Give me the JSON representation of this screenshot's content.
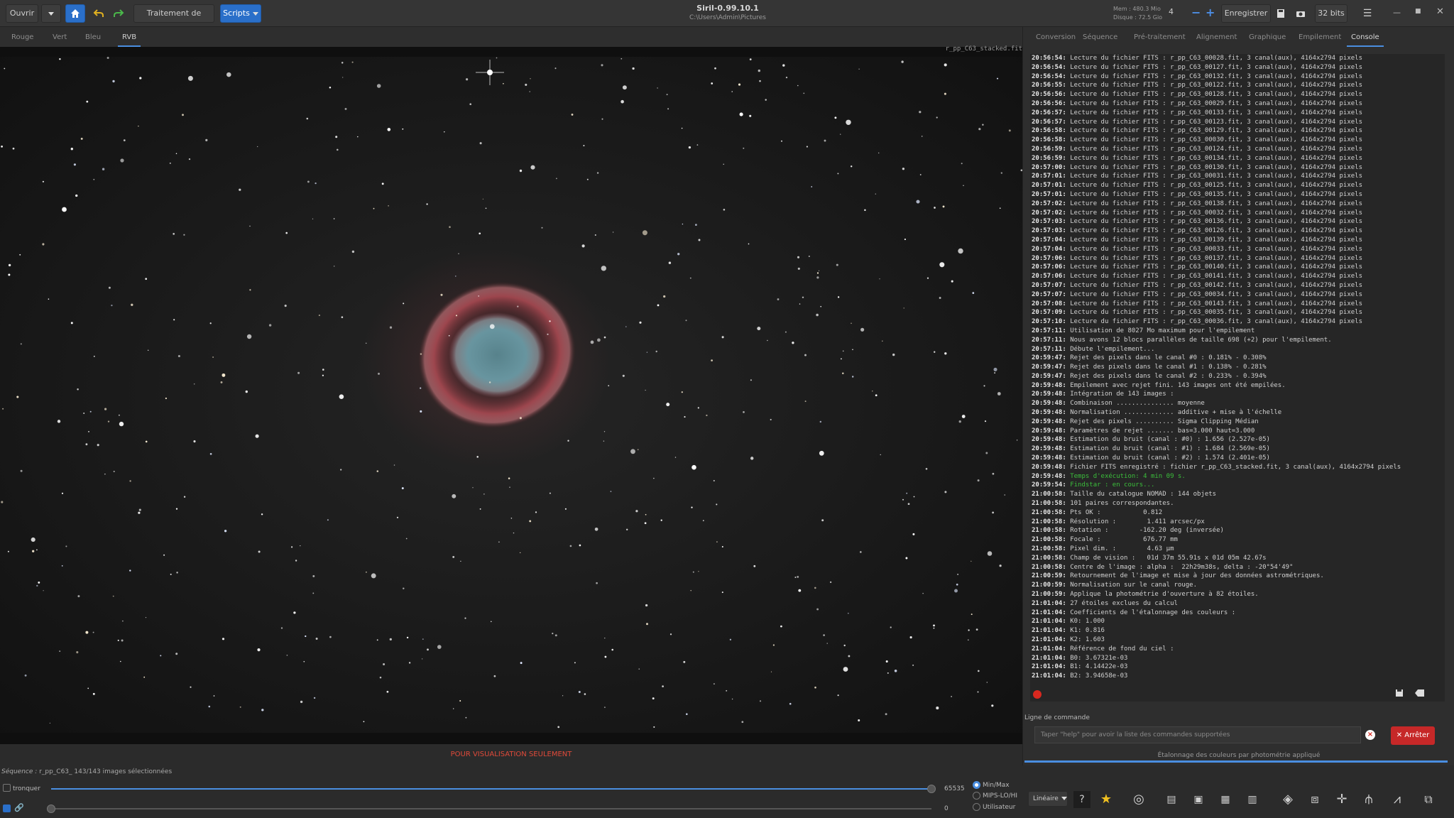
{
  "header": {
    "open_label": "Ouvrir",
    "image_processing_label": "Traitement de l'image",
    "scripts_label": "Scripts",
    "app_title": "Siril-0.99.10.1",
    "app_path": "C:\\Users\\Admin\\Pictures",
    "mem_label": "Mem : 480.3 Mio",
    "disk_label": "Disque : 72.5 Gio",
    "zoom_value": "4",
    "save_label": "Enregistrer",
    "bits_label": "32 bits"
  },
  "channel_tabs": [
    "Rouge",
    "Vert",
    "Bleu",
    "RVB"
  ],
  "image": {
    "filename": "r_pp_C63_stacked.fit",
    "warning": "POUR VISUALISATION SEULEMENT"
  },
  "status": {
    "sequence_label": "Séquence :",
    "sequence_value": "r_pp_C63_ 143/143 images sélectionnées",
    "crop_label": "tronquer",
    "max_value": "65535",
    "min_value": "0",
    "radio_minmax": "Min/Max",
    "radio_mips": "MIPS-LO/HI",
    "radio_user": "Utilisateur"
  },
  "right_tabs": [
    "Conversion",
    "Séquence",
    "Pré-traitement",
    "Alignement",
    "Graphique",
    "Empilement",
    "Console"
  ],
  "console": [
    [
      "20:56:54:",
      "Lecture du fichier FITS : r_pp_C63_00028.fit, 3 canal(aux), 4164x2794 pixels"
    ],
    [
      "20:56:54:",
      "Lecture du fichier FITS : r_pp_C63_00127.fit, 3 canal(aux), 4164x2794 pixels"
    ],
    [
      "20:56:54:",
      "Lecture du fichier FITS : r_pp_C63_00132.fit, 3 canal(aux), 4164x2794 pixels"
    ],
    [
      "20:56:55:",
      "Lecture du fichier FITS : r_pp_C63_00122.fit, 3 canal(aux), 4164x2794 pixels"
    ],
    [
      "20:56:56:",
      "Lecture du fichier FITS : r_pp_C63_00128.fit, 3 canal(aux), 4164x2794 pixels"
    ],
    [
      "20:56:56:",
      "Lecture du fichier FITS : r_pp_C63_00029.fit, 3 canal(aux), 4164x2794 pixels"
    ],
    [
      "20:56:57:",
      "Lecture du fichier FITS : r_pp_C63_00133.fit, 3 canal(aux), 4164x2794 pixels"
    ],
    [
      "20:56:57:",
      "Lecture du fichier FITS : r_pp_C63_00123.fit, 3 canal(aux), 4164x2794 pixels"
    ],
    [
      "20:56:58:",
      "Lecture du fichier FITS : r_pp_C63_00129.fit, 3 canal(aux), 4164x2794 pixels"
    ],
    [
      "20:56:58:",
      "Lecture du fichier FITS : r_pp_C63_00030.fit, 3 canal(aux), 4164x2794 pixels"
    ],
    [
      "20:56:59:",
      "Lecture du fichier FITS : r_pp_C63_00124.fit, 3 canal(aux), 4164x2794 pixels"
    ],
    [
      "20:56:59:",
      "Lecture du fichier FITS : r_pp_C63_00134.fit, 3 canal(aux), 4164x2794 pixels"
    ],
    [
      "20:57:00:",
      "Lecture du fichier FITS : r_pp_C63_00130.fit, 3 canal(aux), 4164x2794 pixels"
    ],
    [
      "20:57:01:",
      "Lecture du fichier FITS : r_pp_C63_00031.fit, 3 canal(aux), 4164x2794 pixels"
    ],
    [
      "20:57:01:",
      "Lecture du fichier FITS : r_pp_C63_00125.fit, 3 canal(aux), 4164x2794 pixels"
    ],
    [
      "20:57:01:",
      "Lecture du fichier FITS : r_pp_C63_00135.fit, 3 canal(aux), 4164x2794 pixels"
    ],
    [
      "20:57:02:",
      "Lecture du fichier FITS : r_pp_C63_00138.fit, 3 canal(aux), 4164x2794 pixels"
    ],
    [
      "20:57:02:",
      "Lecture du fichier FITS : r_pp_C63_00032.fit, 3 canal(aux), 4164x2794 pixels"
    ],
    [
      "20:57:03:",
      "Lecture du fichier FITS : r_pp_C63_00136.fit, 3 canal(aux), 4164x2794 pixels"
    ],
    [
      "20:57:03:",
      "Lecture du fichier FITS : r_pp_C63_00126.fit, 3 canal(aux), 4164x2794 pixels"
    ],
    [
      "20:57:04:",
      "Lecture du fichier FITS : r_pp_C63_00139.fit, 3 canal(aux), 4164x2794 pixels"
    ],
    [
      "20:57:04:",
      "Lecture du fichier FITS : r_pp_C63_00033.fit, 3 canal(aux), 4164x2794 pixels"
    ],
    [
      "20:57:06:",
      "Lecture du fichier FITS : r_pp_C63_00137.fit, 3 canal(aux), 4164x2794 pixels"
    ],
    [
      "20:57:06:",
      "Lecture du fichier FITS : r_pp_C63_00140.fit, 3 canal(aux), 4164x2794 pixels"
    ],
    [
      "20:57:06:",
      "Lecture du fichier FITS : r_pp_C63_00141.fit, 3 canal(aux), 4164x2794 pixels"
    ],
    [
      "20:57:07:",
      "Lecture du fichier FITS : r_pp_C63_00142.fit, 3 canal(aux), 4164x2794 pixels"
    ],
    [
      "20:57:07:",
      "Lecture du fichier FITS : r_pp_C63_00034.fit, 3 canal(aux), 4164x2794 pixels"
    ],
    [
      "20:57:08:",
      "Lecture du fichier FITS : r_pp_C63_00143.fit, 3 canal(aux), 4164x2794 pixels"
    ],
    [
      "20:57:09:",
      "Lecture du fichier FITS : r_pp_C63_00035.fit, 3 canal(aux), 4164x2794 pixels"
    ],
    [
      "20:57:10:",
      "Lecture du fichier FITS : r_pp_C63_00036.fit, 3 canal(aux), 4164x2794 pixels"
    ],
    [
      "20:57:11:",
      "Utilisation de 8027 Mo maximum pour l'empilement"
    ],
    [
      "20:57:11:",
      "Nous avons 12 blocs parallèles de taille 698 (+2) pour l'empilement."
    ],
    [
      "20:57:11:",
      "Débute l'empilement..."
    ],
    [
      "20:59:47:",
      "Rejet des pixels dans le canal #0 : 0.181% - 0.308%"
    ],
    [
      "20:59:47:",
      "Rejet des pixels dans le canal #1 : 0.138% - 0.281%"
    ],
    [
      "20:59:47:",
      "Rejet des pixels dans le canal #2 : 0.233% - 0.394%"
    ],
    [
      "20:59:48:",
      "Empilement avec rejet fini. 143 images ont été empilées."
    ],
    [
      "20:59:48:",
      "Intégration de 143 images :"
    ],
    [
      "20:59:48:",
      "Combinaison ............... moyenne"
    ],
    [
      "20:59:48:",
      "Normalisation ............. additive + mise à l'échelle"
    ],
    [
      "20:59:48:",
      "Rejet des pixels .......... Sigma Clipping Médian"
    ],
    [
      "20:59:48:",
      "Paramètres de rejet ....... bas=3.000 haut=3.000"
    ],
    [
      "20:59:48:",
      "Estimation du bruit (canal : #0) : 1.656 (2.527e-05)"
    ],
    [
      "20:59:48:",
      "Estimation du bruit (canal : #1) : 1.684 (2.569e-05)"
    ],
    [
      "20:59:48:",
      "Estimation du bruit (canal : #2) : 1.574 (2.401e-05)"
    ],
    [
      "20:59:48:",
      "Fichier FITS enregistré : fichier r_pp_C63_stacked.fit, 3 canal(aux), 4164x2794 pixels"
    ],
    [
      "20:59:48:",
      "Temps d'exécution: 4 min 09 s.",
      "green"
    ],
    [
      "20:59:54:",
      "Findstar : en cours...",
      "green"
    ],
    [
      "21:00:58:",
      "Taille du catalogue NOMAD : 144 objets"
    ],
    [
      "21:00:58:",
      "101 paires correspondantes."
    ],
    [
      "21:00:58:",
      "Pts OK :           0.812"
    ],
    [
      "21:00:58:",
      "Résolution :        1.411 arcsec/px"
    ],
    [
      "21:00:58:",
      "Rotation :        -162.20 deg (inversée)"
    ],
    [
      "21:00:58:",
      "Focale :           676.77 mm"
    ],
    [
      "21:00:58:",
      "Pixel dim. :        4.63 µm"
    ],
    [
      "21:00:58:",
      "Champ de vision :   01d 37m 55.91s x 01d 05m 42.67s"
    ],
    [
      "21:00:58:",
      "Centre de l'image : alpha :  22h29m38s, delta : -20°54'49\""
    ],
    [
      "21:00:59:",
      "Retournement de l'image et mise à jour des données astrométriques."
    ],
    [
      "21:00:59:",
      "Normalisation sur le canal rouge."
    ],
    [
      "21:00:59:",
      "Applique la photométrie d'ouverture à 82 étoiles."
    ],
    [
      "21:01:04:",
      "27 étoiles exclues du calcul"
    ],
    [
      "21:01:04:",
      "Coefficients de l'étalonnage des couleurs :"
    ],
    [
      "21:01:04:",
      "K0: 1.000"
    ],
    [
      "21:01:04:",
      "K1: 0.816"
    ],
    [
      "21:01:04:",
      "K2: 1.603"
    ],
    [
      "21:01:04:",
      "Référence de fond du ciel :"
    ],
    [
      "21:01:04:",
      "B0: 3.67321e-03"
    ],
    [
      "21:01:04:",
      "B1: 4.14422e-03"
    ],
    [
      "21:01:04:",
      "B2: 3.94658e-03"
    ]
  ],
  "command": {
    "label": "Ligne de commande",
    "placeholder": "Taper \"help\" pour avoir la liste des commandes supportées",
    "stop_label": "Arrêter",
    "progress_text": "Étalonnage des couleurs par photométrie appliqué"
  },
  "toolbar": {
    "stretch_label": "Linéaire"
  },
  "colors": {
    "accent": "#4a8ee0",
    "stop": "#c62828",
    "warning": "#e04a3a",
    "console_green": "#3bbf3b"
  }
}
